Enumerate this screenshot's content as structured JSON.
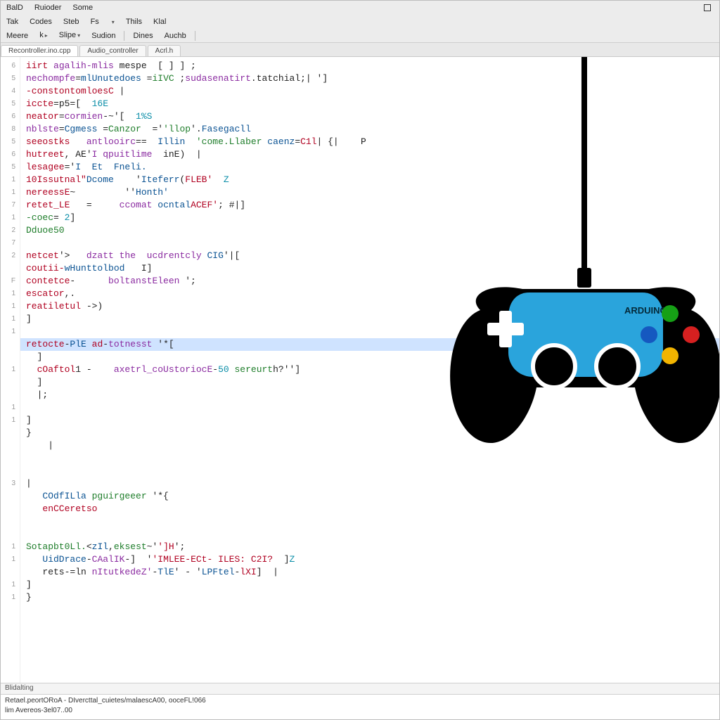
{
  "menu": {
    "row1": [
      "BalD",
      "Ruioder",
      "Some"
    ],
    "row2": [
      "Tak",
      "Codes",
      "Steb",
      "Fs",
      "Thils",
      "Klal"
    ],
    "row3_left": [
      "Meere",
      "k",
      "Slipe",
      "Sudion"
    ],
    "row3_right": [
      "Dines",
      "Auchb"
    ]
  },
  "tabs": [
    {
      "label": "Recontroller.ino.cpp",
      "active": true
    },
    {
      "label": "Audio_controller",
      "active": false
    },
    {
      "label": "Acrl.h",
      "active": false
    }
  ],
  "gutter": [
    "6",
    "5",
    "4",
    "5",
    "6",
    "8",
    "5",
    "6",
    "5",
    "1",
    "1",
    "7",
    "1",
    "2",
    "7",
    "2",
    "",
    "F",
    "1",
    "1",
    "1",
    "1",
    "",
    "",
    "1",
    "",
    "",
    "1",
    "1",
    "",
    "",
    "",
    "",
    "3",
    "",
    "",
    "",
    "",
    "1",
    "1",
    "",
    "1",
    "1"
  ],
  "lines": [
    {
      "segs": [
        [
          "k3",
          "iirt "
        ],
        [
          "k1",
          "agalih-mlis"
        ],
        [
          "pl",
          " mespe  [ ] ] ;"
        ]
      ]
    },
    {
      "segs": [
        [
          "k1",
          "nechompfe"
        ],
        [
          "pl",
          "="
        ],
        [
          "k4",
          "mlUnutedoes"
        ],
        [
          "pl",
          " ="
        ],
        [
          "k2",
          "iIVC"
        ],
        [
          "pl",
          " ;"
        ],
        [
          "k1",
          "sudasenatirt"
        ],
        [
          "pl",
          ".tatchial;| ']"
        ]
      ]
    },
    {
      "segs": [
        [
          "k3",
          "-constontomloesC "
        ],
        [
          "pl",
          "|"
        ]
      ]
    },
    {
      "segs": [
        [
          "k3",
          "iccte"
        ],
        [
          "pl",
          "=p5=[  "
        ],
        [
          "num",
          "16E"
        ]
      ]
    },
    {
      "segs": [
        [
          "k3",
          "neator"
        ],
        [
          "pl",
          "="
        ],
        [
          "k1",
          "cormien"
        ],
        [
          "pl",
          "-~'[  "
        ],
        [
          "num",
          "1%S"
        ]
      ]
    },
    {
      "segs": [
        [
          "k1",
          "nblste"
        ],
        [
          "pl",
          "="
        ],
        [
          "k4",
          "Cgmess "
        ],
        [
          "pl",
          "="
        ],
        [
          "k2",
          "Canzor"
        ],
        [
          "pl",
          "  ='"
        ],
        [
          "k2",
          "'llop"
        ],
        [
          "pl",
          "'."
        ],
        [
          "k4",
          "Fasegacll"
        ]
      ]
    },
    {
      "segs": [
        [
          "k3",
          "seeostks "
        ],
        [
          "k1",
          "  antlooirc"
        ],
        [
          "pl",
          "==  "
        ],
        [
          "k4",
          "Illin "
        ],
        [
          "k2",
          " 'come.Llaber "
        ],
        [
          "k4",
          "caenz"
        ],
        [
          "pl",
          "="
        ],
        [
          "k3",
          "C1l"
        ],
        [
          "pl",
          "| {|    P"
        ]
      ]
    },
    {
      "segs": [
        [
          "k3",
          "hutreet"
        ],
        [
          "pl",
          ", AE'"
        ],
        [
          "k1",
          "I qpuitlime"
        ],
        [
          "pl",
          "  inE)  |"
        ]
      ]
    },
    {
      "segs": [
        [
          "k3",
          "lesagee"
        ],
        [
          "pl",
          "='"
        ],
        [
          "k4",
          "I  Et  Fneli."
        ]
      ]
    },
    {
      "segs": [
        [
          "k3",
          "10Issutnal\""
        ],
        [
          "k4",
          "Dcome"
        ],
        [
          "pl",
          "    '"
        ],
        [
          "k4",
          "Iteferr"
        ],
        [
          "pl",
          "("
        ],
        [
          "k3",
          "FLEB'"
        ],
        [
          "pl",
          "  "
        ],
        [
          "num",
          "Z"
        ]
      ]
    },
    {
      "segs": [
        [
          "k3",
          "nereessE"
        ],
        [
          "pl",
          "~         ''"
        ],
        [
          "k4",
          "Honth'"
        ]
      ]
    },
    {
      "segs": [
        [
          "k3",
          "retet_LE"
        ],
        [
          "pl",
          "   =     "
        ],
        [
          "k1",
          "ccomat"
        ],
        [
          "pl",
          " "
        ],
        [
          "k4",
          "ocntal"
        ],
        [
          "k3",
          "ACEF'"
        ],
        [
          "pl",
          "; #|]"
        ]
      ]
    },
    {
      "segs": [
        [
          "k2",
          "-coec"
        ],
        [
          "pl",
          "= "
        ],
        [
          "num",
          "2"
        ],
        [
          "pl",
          "]"
        ]
      ]
    },
    {
      "segs": [
        [
          "k2",
          "Dduoe50"
        ]
      ]
    },
    {
      "segs": [
        [
          "pl",
          ""
        ]
      ]
    },
    {
      "segs": [
        [
          "k3",
          "netcet"
        ],
        [
          "pl",
          "'>   "
        ],
        [
          "k1",
          "dzatt the  ucdrentcly"
        ],
        [
          "pl",
          " "
        ],
        [
          "k4",
          "CIG"
        ],
        [
          "pl",
          "'|["
        ]
      ]
    },
    {
      "segs": [
        [
          "k3",
          "coutii-"
        ],
        [
          "k4",
          "wHunttolbod"
        ],
        [
          "pl",
          "   I]"
        ]
      ]
    },
    {
      "segs": [
        [
          "k3",
          "contetce"
        ],
        [
          "pl",
          "-      "
        ],
        [
          "k1",
          "boltanstEleen"
        ],
        [
          "pl",
          " ';"
        ]
      ]
    },
    {
      "segs": [
        [
          "k3",
          "escator"
        ],
        [
          "pl",
          ",."
        ]
      ]
    },
    {
      "segs": [
        [
          "k3",
          "reatiletul "
        ],
        [
          "pl",
          "->)"
        ]
      ]
    },
    {
      "segs": [
        [
          "pl",
          "]"
        ]
      ]
    },
    {
      "segs": [
        [
          "pl",
          ""
        ]
      ]
    },
    {
      "hl": true,
      "segs": [
        [
          "k3",
          "retocte"
        ],
        [
          "pl",
          "-"
        ],
        [
          "k4",
          "PlE "
        ],
        [
          "k3",
          "ad"
        ],
        [
          "pl",
          "-"
        ],
        [
          "k1",
          "totnesst"
        ],
        [
          "pl",
          " '*["
        ]
      ]
    },
    {
      "segs": [
        [
          "pl",
          "  ]"
        ]
      ]
    },
    {
      "segs": [
        [
          "pl",
          "  "
        ],
        [
          "k3",
          "cOaftol"
        ],
        [
          "pl",
          "1 -    "
        ],
        [
          "k1",
          "axetrl_coUstoriocE"
        ],
        [
          "pl",
          "-"
        ],
        [
          "num",
          "50"
        ],
        [
          "pl",
          " "
        ],
        [
          "k2",
          "sereurt"
        ],
        [
          "pl",
          "h?'']"
        ]
      ]
    },
    {
      "segs": [
        [
          "pl",
          "  ]"
        ]
      ]
    },
    {
      "segs": [
        [
          "pl",
          "  |;"
        ]
      ]
    },
    {
      "segs": [
        [
          "pl",
          ""
        ]
      ]
    },
    {
      "segs": [
        [
          "pl",
          "]"
        ]
      ]
    },
    {
      "segs": [
        [
          "pl",
          "}"
        ]
      ]
    },
    {
      "segs": [
        [
          "pl",
          "    |"
        ]
      ]
    },
    {
      "segs": [
        [
          "pl",
          ""
        ]
      ]
    },
    {
      "segs": [
        [
          "pl",
          ""
        ]
      ]
    },
    {
      "segs": [
        [
          "pl",
          "|"
        ]
      ]
    },
    {
      "segs": [
        [
          "pl",
          "   "
        ],
        [
          "k4",
          "COdfILla "
        ],
        [
          "k2",
          "pguirgeeer"
        ],
        [
          "pl",
          " '*{"
        ]
      ]
    },
    {
      "segs": [
        [
          "pl",
          "   "
        ],
        [
          "k3",
          "enCCeretso"
        ]
      ]
    },
    {
      "segs": [
        [
          "pl",
          ""
        ]
      ]
    },
    {
      "segs": [
        [
          "pl",
          ""
        ]
      ]
    },
    {
      "segs": [
        [
          "k2",
          "Sotapbt0Ll."
        ],
        [
          "pl",
          "<"
        ],
        [
          "k4",
          "zIl"
        ],
        [
          "pl",
          ","
        ],
        [
          "k2",
          "eksest"
        ],
        [
          "pl",
          "~'"
        ],
        [
          "k3",
          "']H"
        ],
        [
          "pl",
          "';"
        ]
      ]
    },
    {
      "segs": [
        [
          "pl",
          "   "
        ],
        [
          "k4",
          "UidDrace"
        ],
        [
          "pl",
          "-"
        ],
        [
          "k1",
          "CAalIK"
        ],
        [
          "pl",
          "-]  '"
        ],
        [
          "k3",
          "'IMLEE-ECt- ILES: C2I?"
        ],
        [
          "pl",
          "  ]"
        ],
        [
          "num",
          "Z"
        ]
      ]
    },
    {
      "segs": [
        [
          "pl",
          "   rets-=ln "
        ],
        [
          "k1",
          "nItutkedeZ'"
        ],
        [
          "pl",
          "-"
        ],
        [
          "k4",
          "TlE"
        ],
        [
          "pl",
          "' - '"
        ],
        [
          "k4",
          "LPFtel"
        ],
        [
          "pl",
          "-"
        ],
        [
          "k3",
          "lXI"
        ],
        [
          "pl",
          "]  |"
        ]
      ]
    },
    {
      "segs": [
        [
          "pl",
          "]"
        ]
      ]
    },
    {
      "segs": [
        [
          "pl",
          "}"
        ]
      ]
    }
  ],
  "controller_label": "ARDUINO",
  "statusbar": "Blidalting",
  "output": {
    "line1": "Retael.peortORoA - DIvercttal_cuietes/malaescA00, ooceFL!066",
    "line2": "lim   Avereos-3el07..00"
  }
}
